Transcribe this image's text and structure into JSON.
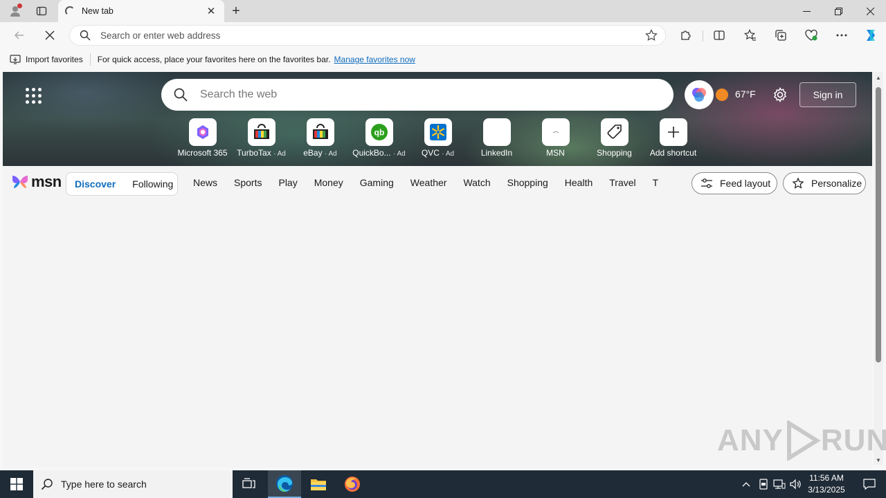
{
  "browser": {
    "tab_title": "New tab",
    "address_placeholder": "Search or enter web address"
  },
  "favorites_bar": {
    "import_label": "Import favorites",
    "message": "For quick access, place your favorites here on the favorites bar.",
    "link": "Manage favorites now"
  },
  "hero": {
    "search_placeholder": "Search the web",
    "temperature": "67°F",
    "sign_in": "Sign in",
    "shortcuts": [
      {
        "label": "Microsoft 365",
        "ad": ""
      },
      {
        "label": "TurboTax",
        "ad": "· Ad"
      },
      {
        "label": "eBay",
        "ad": "· Ad"
      },
      {
        "label": "QuickBo...",
        "ad": "· Ad"
      },
      {
        "label": "QVC",
        "ad": "· Ad"
      },
      {
        "label": "LinkedIn",
        "ad": ""
      },
      {
        "label": "MSN",
        "ad": ""
      },
      {
        "label": "Shopping",
        "ad": ""
      },
      {
        "label": "Add shortcut",
        "ad": ""
      }
    ]
  },
  "msn_nav": {
    "logo": "msn",
    "toggle": [
      "Discover",
      "Following"
    ],
    "categories": [
      "News",
      "Sports",
      "Play",
      "Money",
      "Gaming",
      "Weather",
      "Watch",
      "Shopping",
      "Health",
      "Travel",
      "Trai"
    ],
    "feed_layout": "Feed layout",
    "personalize": "Personalize"
  },
  "watermark": {
    "left": "ANY",
    "right": "RUN"
  },
  "taskbar": {
    "search_placeholder": "Type here to search",
    "time": "11:56 AM",
    "date": "3/13/2025"
  },
  "colors": {
    "accent": "#0f6cbd",
    "taskbar": "#1f2b36",
    "sun": "#f08a24"
  }
}
